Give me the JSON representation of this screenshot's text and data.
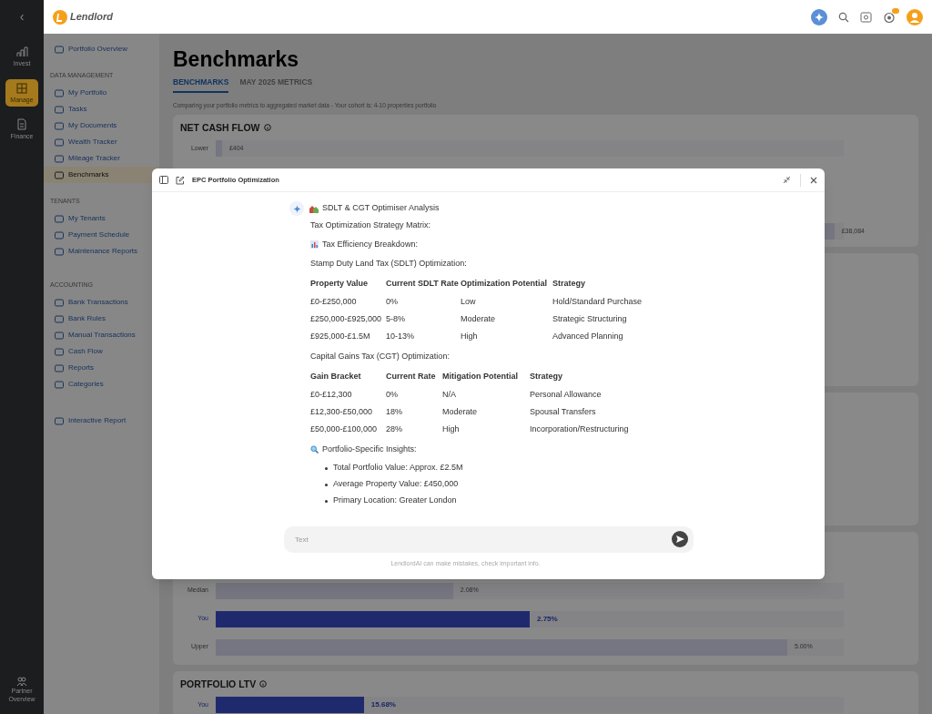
{
  "topbar": {
    "brand": "Lendlord"
  },
  "rail": {
    "back": "‹",
    "items": [
      {
        "label": "Invest",
        "selected": false
      },
      {
        "label": "Manage",
        "selected": true
      },
      {
        "label": "Finance",
        "selected": false
      }
    ],
    "footer": "Partner Overview"
  },
  "sidebar": {
    "items": [
      {
        "kind": "link",
        "label": "Portfolio Overview",
        "selected": false
      },
      {
        "kind": "heading",
        "label": "DATA MANAGEMENT"
      },
      {
        "kind": "link",
        "label": "My Portfolio",
        "selected": false
      },
      {
        "kind": "link",
        "label": "Tasks",
        "selected": false
      },
      {
        "kind": "link",
        "label": "My Documents",
        "selected": false
      },
      {
        "kind": "link",
        "label": "Wealth Tracker",
        "selected": false
      },
      {
        "kind": "link",
        "label": "Mileage Tracker",
        "selected": false
      },
      {
        "kind": "link",
        "label": "Benchmarks",
        "selected": true
      },
      {
        "kind": "heading",
        "label": "TENANTS"
      },
      {
        "kind": "link",
        "label": "My Tenants",
        "selected": false
      },
      {
        "kind": "link",
        "label": "Payment Schedule",
        "selected": false
      },
      {
        "kind": "link",
        "label": "Maintenance Reports",
        "selected": false
      },
      {
        "kind": "heading",
        "label": "ACCOUNTING"
      },
      {
        "kind": "link",
        "label": "Bank Transactions",
        "selected": false
      },
      {
        "kind": "link",
        "label": "Bank Rules",
        "selected": false
      },
      {
        "kind": "link",
        "label": "Manual Transactions",
        "selected": false
      },
      {
        "kind": "link",
        "label": "Cash Flow",
        "selected": false
      },
      {
        "kind": "link",
        "label": "Reports",
        "selected": false
      },
      {
        "kind": "link",
        "label": "Categories",
        "selected": false
      },
      {
        "kind": "link",
        "label": "Interactive Report",
        "selected": false
      }
    ]
  },
  "page": {
    "title": "Benchmarks",
    "tabs": [
      {
        "label": "BENCHMARKS",
        "selected": true
      },
      {
        "label": "MAY 2025 METRICS",
        "selected": false
      }
    ],
    "subtitle": "Comparing your portfolio metrics to aggregated market data - Your cohort is: 4-10 properties portfolio",
    "cards": [
      {
        "title": "NET CASH FLOW",
        "rows": [
          {
            "label": "Lower",
            "value": "£404",
            "level": 0.01,
            "highlight": false
          },
          {
            "value": "£38,084",
            "level": 0.985,
            "highlight": false
          }
        ]
      },
      {
        "rows": [
          {
            "label": "Median",
            "value": "2.08%",
            "level": 0.378,
            "highlight": false
          },
          {
            "label": "You",
            "value": "2.75%",
            "level": 0.5,
            "highlight": true
          },
          {
            "label": "Upper",
            "value": "5.00%",
            "level": 0.91,
            "highlight": false
          }
        ]
      },
      {
        "title": "PORTFOLIO LTV",
        "rows": [
          {
            "label": "You",
            "value": "15.68%",
            "level": 0.236,
            "highlight": true
          }
        ]
      }
    ]
  },
  "dialog": {
    "title": "EPC Portfolio Optimization",
    "message": {
      "heading": "SDLT & CGT Optimiser Analysis",
      "blocks": [
        {
          "kind": "para",
          "text": "Tax Optimization Strategy Matrix:"
        },
        {
          "kind": "breakdown",
          "text": "Tax Efficiency Breakdown:"
        },
        {
          "kind": "para",
          "text": "Stamp Duty Land Tax (SDLT) Optimization:"
        },
        {
          "kind": "table",
          "columns": [
            "Property Value",
            "Current SDLT Rate",
            "Optimization Potential",
            "Strategy"
          ],
          "rows": [
            [
              "£0-£250,000",
              "0%",
              "Low",
              "Hold/Standard Purchase"
            ],
            [
              "£250,000-£925,000",
              "5-8%",
              "Moderate",
              "Strategic Structuring"
            ],
            [
              "£925,000-£1.5M",
              "10-13%",
              "High",
              "Advanced Planning"
            ]
          ]
        },
        {
          "kind": "para",
          "text": "Capital Gains Tax (CGT) Optimization:"
        },
        {
          "kind": "table",
          "columns": [
            "Gain Bracket",
            "Current Rate",
            "Mitigation Potential",
            "Strategy"
          ],
          "rows": [
            [
              "£0-£12,300",
              "0%",
              "N/A",
              "Personal Allowance"
            ],
            [
              "£12,300-£50,000",
              "18%",
              "Moderate",
              "Spousal Transfers"
            ],
            [
              "£50,000-£100,000",
              "28%",
              "High",
              "Incorporation/Restructuring"
            ]
          ]
        },
        {
          "kind": "insights",
          "text": "Portfolio-Specific Insights:"
        },
        {
          "kind": "list",
          "items": [
            "Total Portfolio Value: Approx. £2.5M",
            "Average Property Value: £450,000",
            "Primary Location: Greater London"
          ]
        }
      ]
    },
    "input": {
      "placeholder": "Text"
    },
    "disclaimer": "LendlordAI can make mistakes, check important info."
  }
}
